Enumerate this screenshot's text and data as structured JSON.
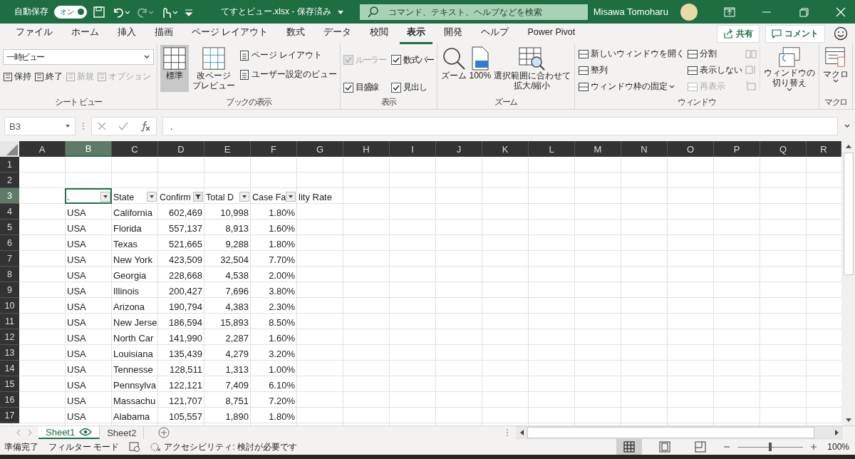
{
  "title_bar": {
    "autosave_label": "自動保存",
    "autosave_toggle": {
      "label": "オン",
      "on": true
    },
    "file_title": "てすとビュー.xlsx - 保存済み",
    "search": {
      "placeholder": "コマンド、テキスト、ヘルプなどを検索"
    },
    "user": "Misawa Tomoharu"
  },
  "menu_tabs": [
    {
      "label": "ファイル",
      "selected": false
    },
    {
      "label": "ホーム",
      "selected": false
    },
    {
      "label": "挿入",
      "selected": false
    },
    {
      "label": "描画",
      "selected": false
    },
    {
      "label": "ページ レイアウト",
      "selected": false
    },
    {
      "label": "数式",
      "selected": false
    },
    {
      "label": "データ",
      "selected": false
    },
    {
      "label": "校閲",
      "selected": false
    },
    {
      "label": "表示",
      "selected": true
    },
    {
      "label": "開発",
      "selected": false
    },
    {
      "label": "ヘルプ",
      "selected": false
    },
    {
      "label": "Power Pivot",
      "selected": false
    }
  ],
  "share_button": "共有",
  "comment_button": "コメント",
  "ribbon": {
    "sheet_view": {
      "dropdown": "一時ビュー",
      "buttons": [
        {
          "label": "保持",
          "disabled": false
        },
        {
          "label": "終了",
          "disabled": false
        },
        {
          "label": "新規",
          "disabled": true
        },
        {
          "label": "オプション",
          "disabled": true
        }
      ],
      "label": "シート ビュー"
    },
    "book_view": {
      "large": [
        {
          "lines": [
            "標準"
          ],
          "selected": true
        },
        {
          "lines": [
            "改ページ",
            "プレビュー"
          ],
          "selected": false
        }
      ],
      "small": [
        "ページ レイアウト",
        "ユーザー設定のビュー"
      ],
      "label": "ブックの表示"
    },
    "show": {
      "checkboxes": [
        {
          "label": "ルーラー",
          "checked": true,
          "disabled": true
        },
        {
          "label": "数式バー",
          "checked": true,
          "disabled": false
        },
        {
          "label": "目盛線",
          "checked": true,
          "disabled": false
        },
        {
          "label": "見出し",
          "checked": true,
          "disabled": false
        }
      ],
      "label": "表示"
    },
    "zoom": {
      "buttons": [
        {
          "lines": [
            "ズーム"
          ]
        },
        {
          "lines": [
            "100%"
          ]
        },
        {
          "lines": [
            "選択範囲に合わせて",
            "拡大/縮小"
          ]
        }
      ],
      "label": "ズーム"
    },
    "window": {
      "items": [
        {
          "label": "新しいウィンドウを開く",
          "disabled": false
        },
        {
          "label": "整列",
          "disabled": false
        },
        {
          "label": "ウィンドウ枠の固定",
          "disabled": false
        },
        {
          "label": "分割",
          "disabled": false
        },
        {
          "label": "表示しない",
          "disabled": false
        },
        {
          "label": "再表示",
          "disabled": true
        }
      ],
      "switch": [
        "ウィンドウの",
        "切り替え"
      ],
      "label": "ウィンドウ"
    },
    "macro": {
      "button": "マクロ",
      "label": "マクロ"
    }
  },
  "formula_bar": {
    "name_box": "B3",
    "formula": "."
  },
  "sheet": {
    "columns": [
      {
        "letter": "A",
        "selected": false
      },
      {
        "letter": "B",
        "selected": true
      },
      {
        "letter": "C",
        "selected": false
      },
      {
        "letter": "D",
        "selected": false
      },
      {
        "letter": "E",
        "selected": false
      },
      {
        "letter": "F",
        "selected": false
      },
      {
        "letter": "G",
        "selected": false
      },
      {
        "letter": "H",
        "selected": false
      },
      {
        "letter": "I",
        "selected": false
      },
      {
        "letter": "J",
        "selected": false
      },
      {
        "letter": "K",
        "selected": false
      },
      {
        "letter": "L",
        "selected": false
      },
      {
        "letter": "M",
        "selected": false
      },
      {
        "letter": "N",
        "selected": false
      },
      {
        "letter": "O",
        "selected": false
      },
      {
        "letter": "P",
        "selected": false
      },
      {
        "letter": "Q",
        "selected": false
      },
      {
        "letter": "R",
        "selected": false
      }
    ],
    "rows": [
      {
        "number": "1",
        "selected": false,
        "kind": "empty"
      },
      {
        "number": "2",
        "selected": false,
        "kind": "empty"
      },
      {
        "number": "3",
        "selected": true,
        "kind": "header",
        "cells": [
          {
            "text": ".",
            "filtered": false,
            "selected": true
          },
          {
            "text": "State",
            "filtered": false,
            "selected": false
          },
          {
            "text": "Confirm",
            "filtered": true,
            "selected": false
          },
          {
            "text": "Total D",
            "filtered": false,
            "selected": false
          },
          {
            "text": "Case Fa",
            "filtered": false,
            "selected": false,
            "overflow": "lity Rate"
          }
        ]
      },
      {
        "number": "4",
        "selected": false,
        "kind": "data",
        "cells": [
          "USA",
          "California",
          "602,469",
          "10,998",
          "1.80%"
        ]
      },
      {
        "number": "5",
        "selected": false,
        "kind": "data",
        "cells": [
          "USA",
          "Florida",
          "557,137",
          "8,913",
          "1.60%"
        ]
      },
      {
        "number": "6",
        "selected": false,
        "kind": "data",
        "cells": [
          "USA",
          "Texas",
          "521,665",
          "9,288",
          "1.80%"
        ]
      },
      {
        "number": "7",
        "selected": false,
        "kind": "data",
        "cells": [
          "USA",
          "New York",
          "423,509",
          "32,504",
          "7.70%"
        ]
      },
      {
        "number": "8",
        "selected": false,
        "kind": "data",
        "cells": [
          "USA",
          "Georgia",
          "228,668",
          "4,538",
          "2.00%"
        ]
      },
      {
        "number": "9",
        "selected": false,
        "kind": "data",
        "cells": [
          "USA",
          "Illinois",
          "200,427",
          "7,696",
          "3.80%"
        ]
      },
      {
        "number": "10",
        "selected": false,
        "kind": "data",
        "cells": [
          "USA",
          "Arizona",
          "190,794",
          "4,383",
          "2.30%"
        ]
      },
      {
        "number": "11",
        "selected": false,
        "kind": "data",
        "cells": [
          "USA",
          "New Jerse",
          "186,594",
          "15,893",
          "8.50%"
        ]
      },
      {
        "number": "12",
        "selected": false,
        "kind": "data",
        "cells": [
          "USA",
          "North Car",
          "141,990",
          "2,287",
          "1.60%"
        ]
      },
      {
        "number": "13",
        "selected": false,
        "kind": "data",
        "cells": [
          "USA",
          "Louisiana",
          "135,439",
          "4,279",
          "3.20%"
        ]
      },
      {
        "number": "14",
        "selected": false,
        "kind": "data",
        "cells": [
          "USA",
          "Tennesse",
          "128,511",
          "1,313",
          "1.00%"
        ]
      },
      {
        "number": "15",
        "selected": false,
        "kind": "data",
        "cells": [
          "USA",
          "Pennsylva",
          "122,121",
          "7,409",
          "6.10%"
        ]
      },
      {
        "number": "16",
        "selected": false,
        "kind": "data",
        "cells": [
          "USA",
          "Massachu",
          "121,707",
          "8,751",
          "7.20%"
        ]
      },
      {
        "number": "17",
        "selected": false,
        "kind": "data",
        "cells": [
          "USA",
          "Alabama",
          "105,557",
          "1,890",
          "1.80%"
        ]
      }
    ]
  },
  "sheet_tabs": [
    {
      "name": "Sheet1",
      "selected": true
    },
    {
      "name": "Sheet2",
      "selected": false
    }
  ],
  "status_bar": {
    "ready": "準備完了",
    "mode": "フィルター モード",
    "accessibility": "アクセシビリティ: 検討が必要です",
    "views": [
      {
        "kind": "normal",
        "selected": true
      },
      {
        "kind": "page_layout",
        "selected": false
      },
      {
        "kind": "page_break",
        "selected": false
      }
    ],
    "zoom_slider": {
      "level": 0.5
    },
    "zoom": "100%"
  }
}
